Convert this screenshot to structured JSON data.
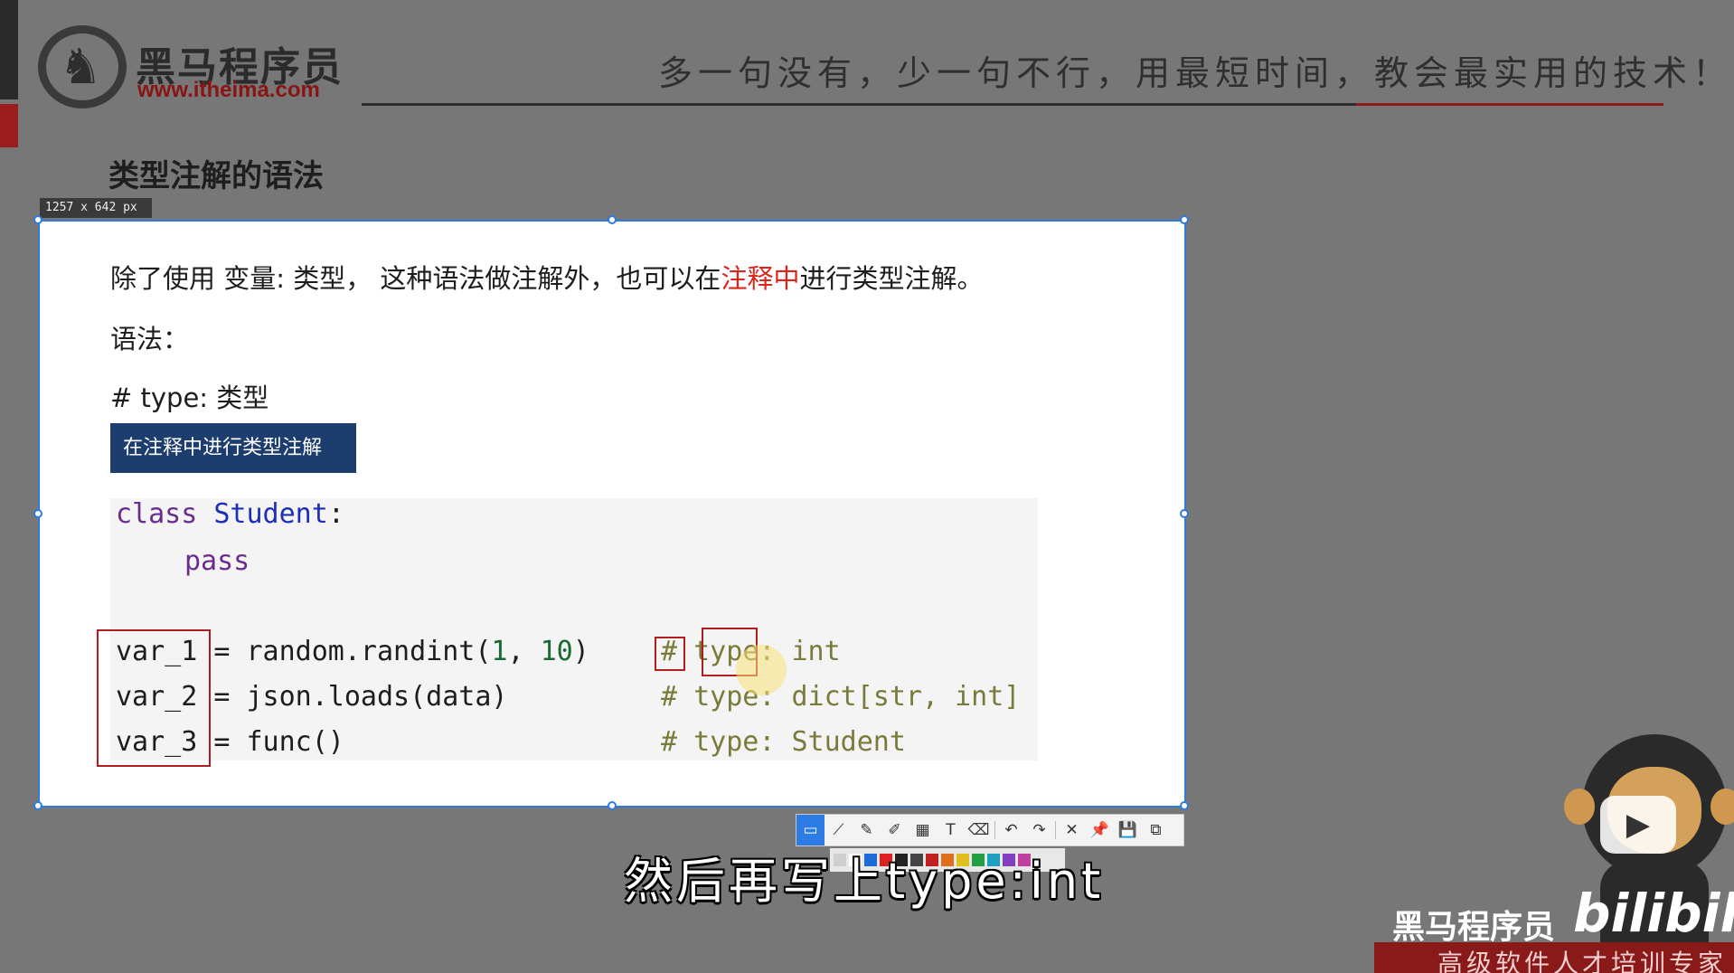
{
  "header": {
    "brand_cn": "黑马程序员",
    "brand_url": "www.itheima.com",
    "slogan": "多一句没有，少一句不行，用最短时间，教会最实用的技术！"
  },
  "slide": {
    "title": "类型注解的语法",
    "intro_before": "除了使用 变量: 类型， 这种语法做注解外，也可以在",
    "intro_highlight": "注释中",
    "intro_after": "进行类型注解。",
    "syntax_label": "语法：",
    "syntax_line": "# type: 类型",
    "banner": "在注释中进行类型注解"
  },
  "code": {
    "class_kw": "class",
    "class_name": "Student",
    "class_colon": ":",
    "pass_kw": "pass",
    "lines": [
      {
        "var": "var_1",
        "expr_a": " = random.randint(",
        "n1": "1",
        "mid": ", ",
        "n2": "10",
        "expr_b": ")",
        "comment_hash": "#",
        "comment_body": " type: int"
      },
      {
        "var": "var_2",
        "expr": " = json.loads(data)",
        "comment": "# type: dict[str, int]"
      },
      {
        "var": "var_3",
        "expr": " = func()",
        "comment": "# type: Student"
      }
    ]
  },
  "selection": {
    "dimensions": "1257 x 642  px"
  },
  "toolbar": {
    "tools": [
      "rectangle-icon",
      "polyline-icon",
      "pen-icon",
      "marker-icon",
      "mosaic-icon",
      "text-icon",
      "eraser-icon",
      "undo-icon",
      "redo-icon",
      "close-icon",
      "pin-icon",
      "save-icon",
      "copy-icon"
    ],
    "glyphs": [
      "▭",
      "⟋",
      "✎",
      "✐",
      "▦",
      "T",
      "⌫",
      "↶",
      "↷",
      "✕",
      "📌",
      "💾",
      "⧉"
    ],
    "colors": [
      "#cfcfcf",
      "#ffffff",
      "#1e6bd6",
      "#e02020",
      "#222222",
      "#444444",
      "#c02020",
      "#e07020",
      "#e0c020",
      "#20a040",
      "#20a0c0",
      "#8040c0",
      "#c040a0"
    ]
  },
  "subtitle": "然后再写上type:int",
  "watermark": {
    "brand": "黑马程序员",
    "platform": "bilibili",
    "tagline": "高级软件人才培训专家"
  }
}
